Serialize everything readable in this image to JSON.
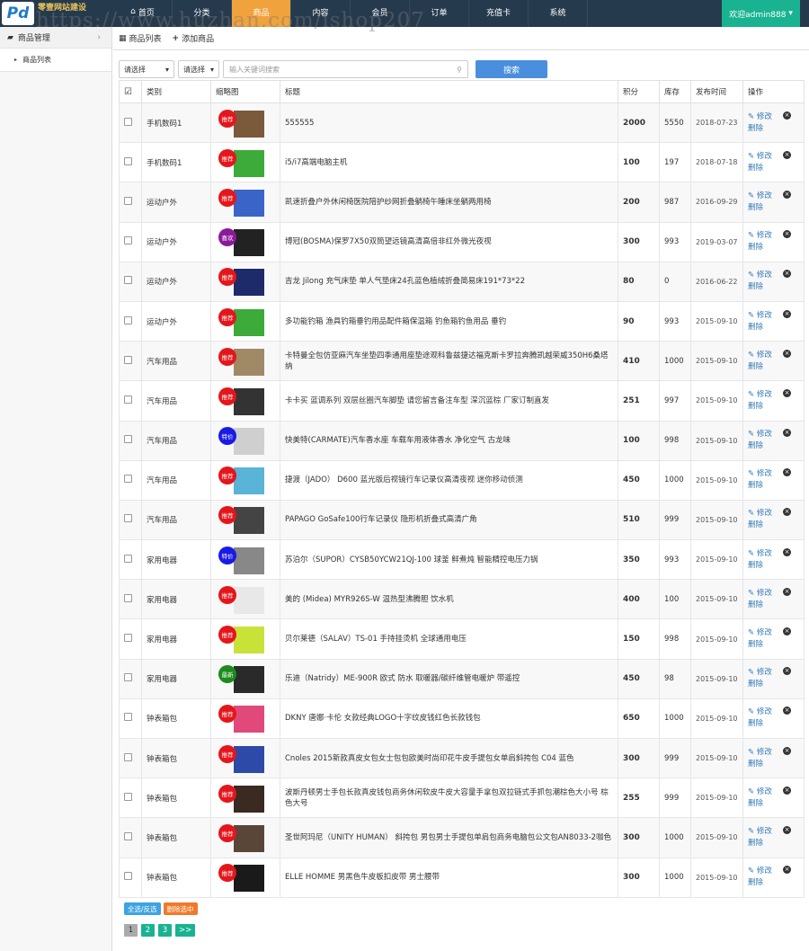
{
  "logo": {
    "mark": "Pd",
    "brand": "零壹网站建设"
  },
  "watermark": "https://www.huzhan.com/ishop207",
  "nav": {
    "items": [
      {
        "label": "首页",
        "icon": "home-icon",
        "glyph": "⌂",
        "active": false
      },
      {
        "label": "分类",
        "active": false
      },
      {
        "label": "商品",
        "active": true
      },
      {
        "label": "内容",
        "active": false
      },
      {
        "label": "会员",
        "active": false
      },
      {
        "label": "订单",
        "active": false
      },
      {
        "label": "充值卡",
        "active": false
      },
      {
        "label": "系统",
        "active": false
      }
    ]
  },
  "user": {
    "label": "欢迎admin888"
  },
  "sidebar": {
    "group": "商品管理",
    "item": "商品列表"
  },
  "tabs": [
    {
      "icon": "grid-icon",
      "glyph": "▦",
      "label": "商品列表"
    },
    {
      "icon": "plus-icon",
      "glyph": "+",
      "label": "添加商品"
    }
  ],
  "search": {
    "select1": "请选择",
    "select2": "请选择",
    "placeholder": "输入关键词搜索",
    "button": "搜索"
  },
  "table": {
    "headers": [
      "类别",
      "缩略图",
      "标题",
      "积分",
      "库存",
      "发布时间",
      "操作"
    ],
    "rows": [
      {
        "cat": "手机数码1",
        "badge": "推荐",
        "badge_color": "#e4161b",
        "thumb": "#7a5a3a",
        "title": "555555",
        "points": "2000",
        "stock": "5550",
        "date": "2018-07-23"
      },
      {
        "cat": "手机数码1",
        "badge": "推荐",
        "badge_color": "#e4161b",
        "thumb": "#3cab3a",
        "title": "i5/i7高端电脑主机",
        "points": "100",
        "stock": "197",
        "date": "2018-07-18"
      },
      {
        "cat": "运动户外",
        "badge": "推荐",
        "badge_color": "#e4161b",
        "thumb": "#3a64c8",
        "title": "凯速折叠户外休闲椅医院陪护纱网折叠躺椅午睡床坐躺两用椅",
        "points": "200",
        "stock": "987",
        "date": "2016-09-29"
      },
      {
        "cat": "运动户外",
        "badge": "喜欢",
        "badge_color": "#8b1a9b",
        "thumb": "#222222",
        "title": "博冠(BOSMA)保罗7X50双筒望远镜高清高倍非红外微光夜视",
        "points": "300",
        "stock": "993",
        "date": "2019-03-07"
      },
      {
        "cat": "运动户外",
        "badge": "推荐",
        "badge_color": "#e4161b",
        "thumb": "#1d2b6a",
        "title": "吉龙 Jilong 充气床垫 单人气垫床24孔蓝色植绒折叠简易床191*73*22",
        "points": "80",
        "stock": "0",
        "date": "2016-06-22"
      },
      {
        "cat": "运动户外",
        "badge": "推荐",
        "badge_color": "#e4161b",
        "thumb": "#3cab3a",
        "title": "多功能钓箱 渔具钓箱垂钓用品配件箱保温箱 钓鱼箱钓鱼用品 垂钓",
        "points": "90",
        "stock": "993",
        "date": "2015-09-10"
      },
      {
        "cat": "汽车用品",
        "badge": "推荐",
        "badge_color": "#e4161b",
        "thumb": "#a08a66",
        "title": "卡特曼全包仿亚麻汽车坐垫四季通用座垫途观科鲁兹捷达福克斯卡罗拉奔腾凯越荣威350H6桑塔纳",
        "points": "410",
        "stock": "1000",
        "date": "2015-09-10"
      },
      {
        "cat": "汽车用品",
        "badge": "推荐",
        "badge_color": "#e4161b",
        "thumb": "#333333",
        "title": "卡卡买 蓝调系列 双层丝圈汽车脚垫 请您留言备注车型 深沉蓝棕 厂家订制直发",
        "points": "251",
        "stock": "997",
        "date": "2015-09-10"
      },
      {
        "cat": "汽车用品",
        "badge": "特价",
        "badge_color": "#1a1ae6",
        "thumb": "#cfcfcf",
        "title": "快美特(CARMATE)汽车香水座 车载车用液体香水 净化空气 古龙味",
        "points": "100",
        "stock": "998",
        "date": "2015-09-10"
      },
      {
        "cat": "汽车用品",
        "badge": "推荐",
        "badge_color": "#e4161b",
        "thumb": "#5ab4d8",
        "title": "捷渡（JADO） D600 蓝光版后视镜行车记录仪高清夜视 迷你移动侦测",
        "points": "450",
        "stock": "1000",
        "date": "2015-09-10"
      },
      {
        "cat": "汽车用品",
        "badge": "推荐",
        "badge_color": "#e4161b",
        "thumb": "#444444",
        "title": "PAPAGO GoSafe100行车记录仪 隐形机折叠式高清广角",
        "points": "510",
        "stock": "999",
        "date": "2015-09-10"
      },
      {
        "cat": "家用电器",
        "badge": "特价",
        "badge_color": "#1a1ae6",
        "thumb": "#888888",
        "title": "苏泊尔（SUPOR）CYSB50YCW21QJ-100 球釜 鲜煮炖 智能精控电压力锅",
        "points": "350",
        "stock": "993",
        "date": "2015-09-10"
      },
      {
        "cat": "家用电器",
        "badge": "推荐",
        "badge_color": "#e4161b",
        "thumb": "#e8e8e8",
        "title": "美的 (Midea) MYR926S-W 温热型沸腾胆 饮水机",
        "points": "400",
        "stock": "100",
        "date": "2015-09-10"
      },
      {
        "cat": "家用电器",
        "badge": "推荐",
        "badge_color": "#e4161b",
        "thumb": "#c9e23a",
        "title": "贝尔莱德（SALAV）TS-01 手持挂烫机 全球通用电压",
        "points": "150",
        "stock": "998",
        "date": "2015-09-10"
      },
      {
        "cat": "家用电器",
        "badge": "最新",
        "badge_color": "#1c8a1c",
        "thumb": "#2a2a2a",
        "title": "乐迪（Natridy）ME-900R 欧式 防水 取暖器/碳纤维管电暖炉 带遥控",
        "points": "450",
        "stock": "98",
        "date": "2015-09-10"
      },
      {
        "cat": "钟表箱包",
        "badge": "推荐",
        "badge_color": "#e4161b",
        "thumb": "#e0497a",
        "title": "DKNY 唐娜·卡伦 女款经典LOGO十字纹皮钱红色长款钱包",
        "points": "650",
        "stock": "1000",
        "date": "2015-09-10"
      },
      {
        "cat": "钟表箱包",
        "badge": "推荐",
        "badge_color": "#e4161b",
        "thumb": "#2e4aa8",
        "title": "Cnoles 2015新款真皮女包女士包包欧美时尚印花牛皮手提包女单肩斜挎包 C04 蓝色",
        "points": "300",
        "stock": "999",
        "date": "2015-09-10"
      },
      {
        "cat": "钟表箱包",
        "badge": "推荐",
        "badge_color": "#e4161b",
        "thumb": "#3a2a22",
        "title": "波斯丹顿男士手包长款真皮钱包商务休闲软皮牛皮大容量手拿包双拉链式手抓包潮棕色大小号 棕色大号",
        "points": "255",
        "stock": "999",
        "date": "2015-09-10"
      },
      {
        "cat": "钟表箱包",
        "badge": "推荐",
        "badge_color": "#e4161b",
        "thumb": "#5a4638",
        "title": "圣世阿玛尼（UNITY HUMAN） 斜挎包 男包男士手提包单肩包商务电脑包公文包AN8033-2咖色",
        "points": "300",
        "stock": "1000",
        "date": "2015-09-10"
      },
      {
        "cat": "钟表箱包",
        "badge": "推荐",
        "badge_color": "#e4161b",
        "thumb": "#1a1a1a",
        "title": "ELLE HOMME 男黑色牛皮板扣皮带 男士腰带",
        "points": "300",
        "stock": "1000",
        "date": "2015-09-10"
      }
    ],
    "ops": {
      "edit": "修改",
      "delete": "删除"
    }
  },
  "bulk": [
    {
      "label": "全选/反选",
      "color": "#3da3e3"
    },
    {
      "label": "删除选中",
      "color": "#f07a2a"
    }
  ],
  "pager": [
    {
      "label": "1",
      "current": true
    },
    {
      "label": "2"
    },
    {
      "label": "3"
    },
    {
      "label": ">>"
    }
  ]
}
